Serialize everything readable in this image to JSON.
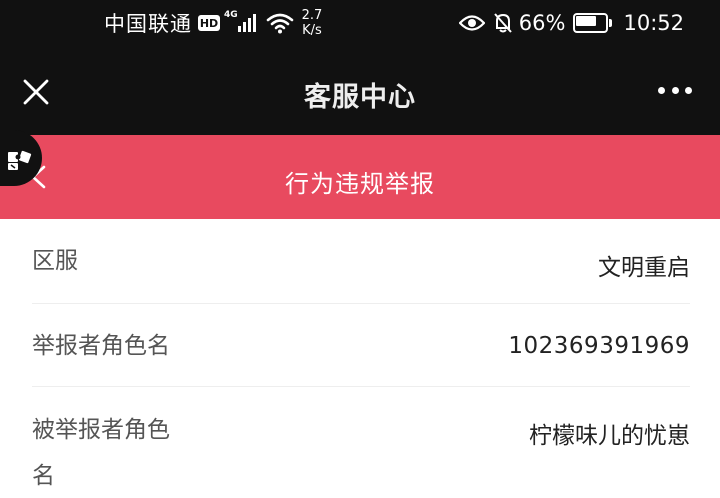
{
  "status_bar": {
    "carrier": "中国联通",
    "hd": "HD",
    "network": "4G",
    "speed_value": "2.7",
    "speed_unit": "K/s",
    "battery": "66%",
    "battery_level": 0.66,
    "time": "10:52"
  },
  "header": {
    "title": "客服中心",
    "close_icon": "close-icon",
    "more_icon": "more-icon"
  },
  "page": {
    "title": "行为违规举报",
    "back_icon": "chevron-left-icon",
    "accent_color": "#e84a5f"
  },
  "form": {
    "rows": [
      {
        "label": "区服",
        "value": "文明重启"
      },
      {
        "label": "举报者角色名",
        "value": "102369391969"
      },
      {
        "label": "被举报者角色名",
        "value": "柠檬味儿的忧崽"
      }
    ],
    "row3_label_line1": "被举报者角色",
    "row3_label_line2": "名"
  }
}
